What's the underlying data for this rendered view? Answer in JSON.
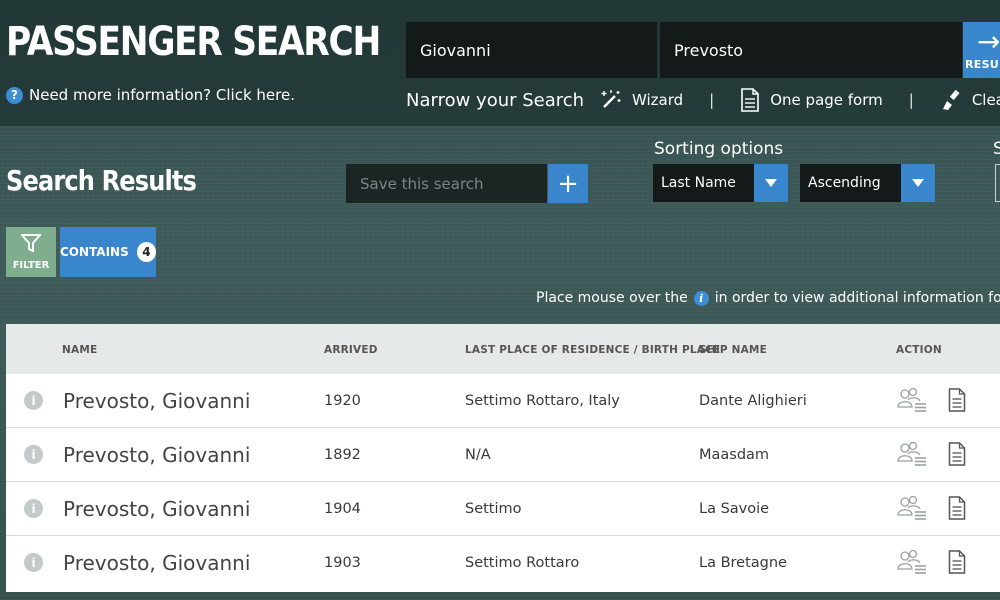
{
  "header": {
    "title": "PASSENGER SEARCH",
    "help_text": "Need more information? Click here.",
    "first_name_value": "Giovanni",
    "last_name_value": "Prevosto",
    "results_label": "RESULTS"
  },
  "narrow": {
    "label": "Narrow your Search",
    "wizard": "Wizard",
    "one_page_form": "One page form",
    "clear": "Clear"
  },
  "toolbar": {
    "results_title": "Search Results",
    "save_placeholder": "Save this search",
    "sorting_label": "Sorting options",
    "second_label": "S",
    "sort_field": "Last Name",
    "sort_order": "Ascending",
    "filter_label": "FILTER",
    "contains_label": "CONTAINS",
    "contains_count": "4"
  },
  "hint": {
    "before": "Place mouse over the",
    "after": "in order to view additional information for"
  },
  "table": {
    "headers": {
      "name": "NAME",
      "arrived": "ARRIVED",
      "residence": "LAST PLACE OF RESIDENCE / BIRTH PLACE",
      "ship": "SHIP NAME",
      "action": "ACTION"
    },
    "rows": [
      {
        "name": "Prevosto, Giovanni",
        "arrived": "1920",
        "residence": "Settimo Rottaro, Italy",
        "ship": "Dante Alighieri"
      },
      {
        "name": "Prevosto, Giovanni",
        "arrived": "1892",
        "residence": "N/A",
        "ship": "Maasdam"
      },
      {
        "name": "Prevosto, Giovanni",
        "arrived": "1904",
        "residence": "Settimo",
        "ship": "La Savoie"
      },
      {
        "name": "Prevosto, Giovanni",
        "arrived": "1903",
        "residence": "Settimo Rottaro",
        "ship": "La Bretagne"
      }
    ]
  },
  "colors": {
    "accent_blue": "#3a86cc",
    "filter_green": "#7fae8e",
    "background": "#2e4a48"
  }
}
